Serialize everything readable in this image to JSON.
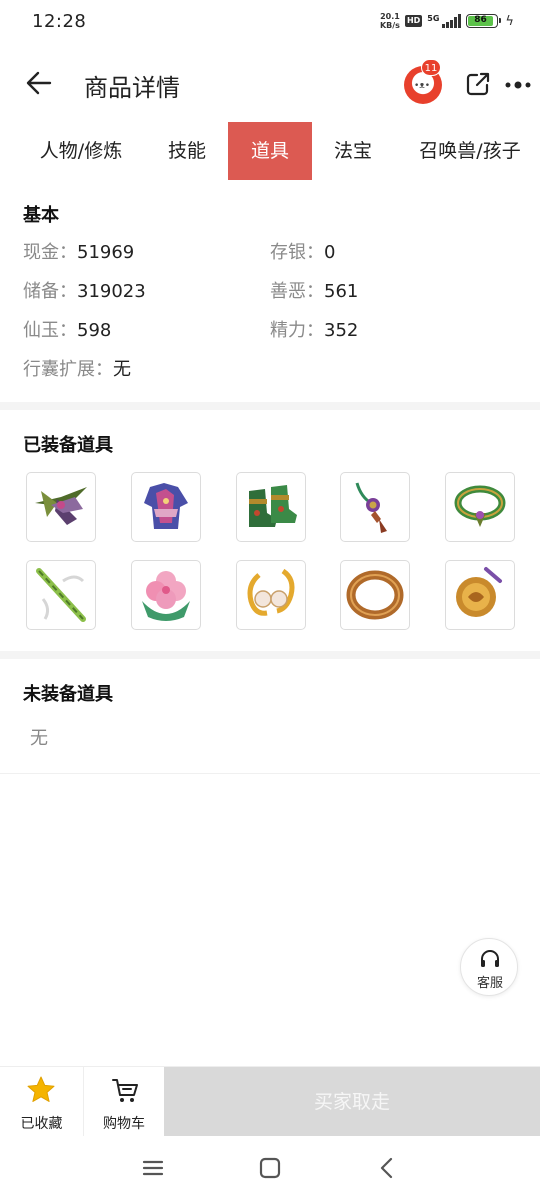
{
  "status_bar": {
    "time": "12:28",
    "net_speed_value": "20.1",
    "net_speed_unit": "KB/s",
    "hd": "HD",
    "signal_label": "5G",
    "battery": "86"
  },
  "header": {
    "title": "商品详情",
    "notification_count": "11"
  },
  "tabs": [
    {
      "label": "人物/修炼",
      "active": false
    },
    {
      "label": "技能",
      "active": false
    },
    {
      "label": "道具",
      "active": true
    },
    {
      "label": "法宝",
      "active": false
    },
    {
      "label": "召唤兽/孩子",
      "active": false
    }
  ],
  "basic": {
    "title": "基本",
    "cash_label": "现金：",
    "cash": "51969",
    "savings_label": "存银：",
    "savings": "0",
    "reserve_label": "储备：",
    "reserve": "319023",
    "karma_label": "善恶：",
    "karma": "561",
    "jade_label": "仙玉：",
    "jade": "598",
    "energy_label": "精力：",
    "energy": "352",
    "bag_label": "行囊扩展：",
    "bag": "无"
  },
  "equipped": {
    "title": "已装备道具",
    "items": [
      {
        "icon": "feathered-headwear-icon"
      },
      {
        "icon": "armor-robe-icon"
      },
      {
        "icon": "boots-icon"
      },
      {
        "icon": "pendant-necklace-icon"
      },
      {
        "icon": "jade-bracelet-icon"
      },
      {
        "icon": "bamboo-staff-icon"
      },
      {
        "icon": "flower-jade-icon"
      },
      {
        "icon": "pearl-earrings-icon"
      },
      {
        "icon": "bronze-ring-icon"
      },
      {
        "icon": "golden-medallion-icon"
      }
    ]
  },
  "unequipped": {
    "title": "未装备道具",
    "value": "无"
  },
  "service": {
    "label": "客服"
  },
  "bottom_bar": {
    "favorite_label": "已收藏",
    "cart_label": "购物车",
    "buy_label": "买家取走"
  },
  "colors": {
    "accent": "#dc5a52",
    "badge": "#e8402c",
    "star": "#f5b400",
    "disabled_button": "#d9d9d9"
  }
}
